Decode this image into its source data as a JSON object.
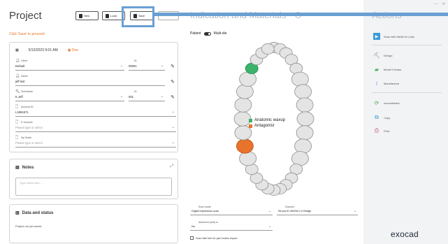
{
  "left": {
    "title": "Project",
    "toolbar": {
      "new": "New",
      "load": "Load",
      "save": "Save"
    },
    "hint": "Click 'Save' to proceed",
    "date": "5/13/2023 9:01 AM",
    "due": "Due",
    "fields": {
      "client_label": "Client",
      "client_value": "Default",
      "id_label": "ID",
      "id_value": "00001",
      "name_label": "Name",
      "name_value": "jeff test",
      "tech_label": "Technician",
      "tech_value": "K.Jeff",
      "tech_id_label": "ID",
      "tech_id_value": "001",
      "account_label": "Account ID",
      "account_value": "L1881571",
      "voucher_label": "E-Voucher",
      "voucher_placeholder": "Please type or select",
      "zip_label": "Zip Scale",
      "zip_placeholder": "Please type or select"
    },
    "notes": {
      "title": "Notes",
      "placeholder": "Type notes here..."
    },
    "status": {
      "title": "Data and status",
      "text": "Project not yet saved"
    }
  },
  "middle": {
    "title": "Indication and Materials",
    "patient": "Patient",
    "multidie": "Multi-die",
    "legend": [
      {
        "label": "Anatomic waxup",
        "color": "#3bb36a"
      },
      {
        "label": "Antagonist",
        "color": "#e8732a"
      }
    ],
    "scan_mode_label": "Scan mode",
    "scan_mode_value": "Digital impression scan",
    "scanner_label": "Scanner",
    "scanner_value": "Sirona ID 3000W 2.0 Bridge",
    "abutment_label": "Abutment (and) to",
    "abutment_value": "No",
    "checkbox_label": "Scan bite fork for jaw motion import"
  },
  "right": {
    "title": "Actions",
    "actions": [
      {
        "label": "Scan with Medit for Labs",
        "icon": "scan-icon",
        "color": "#3a9bd8"
      },
      {
        "label": "Design",
        "icon": "design-icon",
        "color": "#8a8f95"
      },
      {
        "label": "Model Creator",
        "icon": "model-creator-icon",
        "color": "#4caf50"
      },
      {
        "label": "Manufacture",
        "icon": "manufacture-icon",
        "color": "#3a6fc4"
      },
      {
        "label": "exocadshare",
        "icon": "share-icon",
        "color": "#4caf50"
      },
      {
        "label": "Copy",
        "icon": "copy-icon",
        "color": "#3a9bd8"
      },
      {
        "label": "Print",
        "icon": "print-icon",
        "color": "#c2477a"
      }
    ],
    "logo": "exocad"
  },
  "colors": {
    "highlight": "#6a9fd4",
    "antagonist": "#e8732a",
    "waxup": "#3bb36a"
  }
}
